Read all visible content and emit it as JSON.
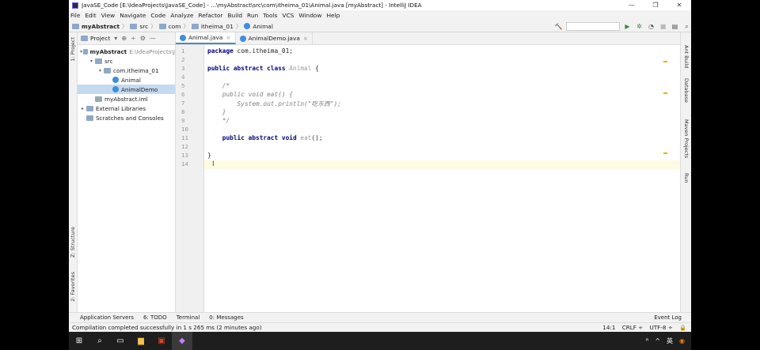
{
  "window": {
    "title": "JavaSE_Code [E:\\IdeaProjects\\JavaSE_Code] - ...\\myAbstract\\src\\com\\itheima_01\\Animal.java [myAbstract] - IntelliJ IDEA",
    "controls": [
      "—",
      "❐",
      "✕"
    ]
  },
  "menu": [
    "File",
    "Edit",
    "View",
    "Navigate",
    "Code",
    "Analyze",
    "Refactor",
    "Build",
    "Run",
    "Tools",
    "VCS",
    "Window",
    "Help"
  ],
  "breadcrumb": [
    "myAbstract",
    "src",
    "com",
    "itheima_01",
    "Animal"
  ],
  "left_tabs": [
    "1: Project",
    "Z: Structure",
    "2: Favorites"
  ],
  "right_tabs": [
    "Ant Build",
    "Database",
    "Maven Projects",
    "Run"
  ],
  "project_panel": {
    "title": "Project",
    "tree": [
      {
        "label": "myAbstract",
        "extra": "E:\\IdeaProjects\\J",
        "indent": 0,
        "arrow": "▾",
        "icon": "module-folder-icon",
        "bold": true
      },
      {
        "label": "src",
        "extra": "",
        "indent": 1,
        "arrow": "▾",
        "icon": "folder-icon"
      },
      {
        "label": "com.itheima_01",
        "extra": "",
        "indent": 2,
        "arrow": "▾",
        "icon": "package-icon"
      },
      {
        "label": "Animal",
        "extra": "",
        "indent": 3,
        "arrow": "",
        "icon": "class-icon"
      },
      {
        "label": "AnimalDemo",
        "extra": "",
        "indent": 3,
        "arrow": "",
        "icon": "class-icon",
        "selected": true
      },
      {
        "label": "myAbstract.iml",
        "extra": "",
        "indent": 1,
        "arrow": "",
        "icon": "iml-file-icon"
      },
      {
        "label": "External Libraries",
        "extra": "",
        "indent": 0,
        "arrow": "▸",
        "icon": "library-icon"
      },
      {
        "label": "Scratches and Consoles",
        "extra": "",
        "indent": 0,
        "arrow": "",
        "icon": "scratches-icon"
      }
    ]
  },
  "tabs": [
    {
      "label": "Animal.java",
      "active": true
    },
    {
      "label": "AnimalDemo.java",
      "active": false
    }
  ],
  "code_lines": [
    [
      {
        "t": "package",
        "c": "kw"
      },
      {
        "t": " com.itheima_01;",
        "c": ""
      }
    ],
    [],
    [
      {
        "t": "public abstract class",
        "c": "kw"
      },
      {
        "t": " ",
        "c": ""
      },
      {
        "t": "Animal",
        "c": "cls"
      },
      {
        "t": " {",
        "c": ""
      }
    ],
    [],
    [
      {
        "t": "    /*",
        "c": "cmt"
      }
    ],
    [
      {
        "t": "    public void eat() {",
        "c": "cmt"
      }
    ],
    [
      {
        "t": "        System.out.println(\"吃东西\");",
        "c": "cmt"
      }
    ],
    [
      {
        "t": "    }",
        "c": "cmt"
      }
    ],
    [
      {
        "t": "    */",
        "c": "cmt"
      }
    ],
    [],
    [
      {
        "t": "    public abstract void",
        "c": "kw"
      },
      {
        "t": " ",
        "c": ""
      },
      {
        "t": "eat",
        "c": "cls"
      },
      {
        "t": "();",
        "c": ""
      }
    ],
    [],
    [
      {
        "t": "}",
        "c": ""
      }
    ],
    []
  ],
  "current_line": 14,
  "bottom_tools": [
    "Application Servers",
    "6: TODO",
    "Terminal",
    "0: Messages"
  ],
  "event_log": "Event Log",
  "status": {
    "message": "Compilation completed successfully in 1 s 265 ms (2 minutes ago)",
    "position": "14:1",
    "line_sep": "CRLF ÷",
    "encoding": "UTF-8 ÷"
  },
  "taskbar": {
    "tray": [
      "ᴿ",
      "^",
      "英"
    ]
  }
}
